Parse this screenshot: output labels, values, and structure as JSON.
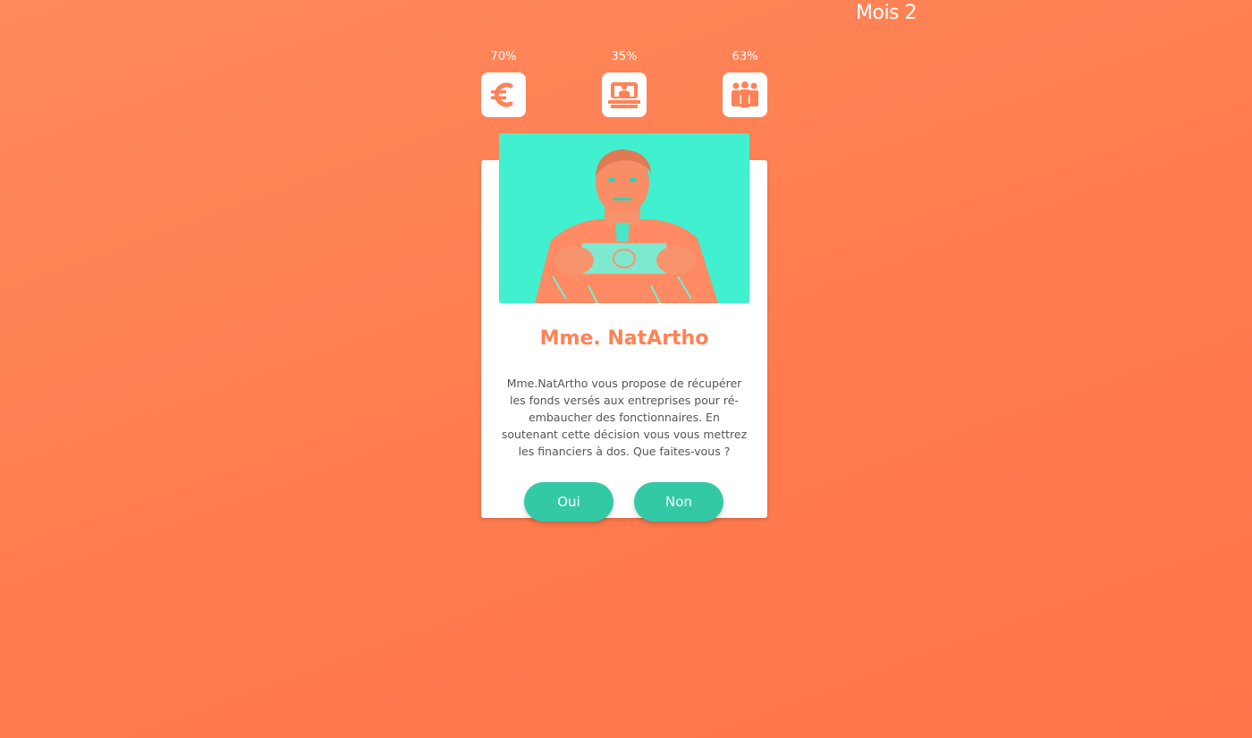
{
  "header": {
    "month_label": "Mois 2"
  },
  "stats": [
    {
      "percent": "70%",
      "icon": "euro-icon"
    },
    {
      "percent": "35%",
      "icon": "government-icon"
    },
    {
      "percent": "63%",
      "icon": "people-icon"
    }
  ],
  "card": {
    "image": "portrait-photo",
    "name": "Mme. NatArtho",
    "description": "Mme.NatArtho vous propose de récupérer les fonds versés aux entreprises pour ré-embaucher des fonctionnaires. En soutenant cette décision vous vous mettrez les financiers à dos. Que faites-vous ?",
    "yes_label": "Oui",
    "no_label": "Non"
  },
  "colors": {
    "background": "#ff7f52",
    "accent": "#ff8256",
    "photo_tint": "#41f0cf",
    "button": "#33c9a4"
  }
}
